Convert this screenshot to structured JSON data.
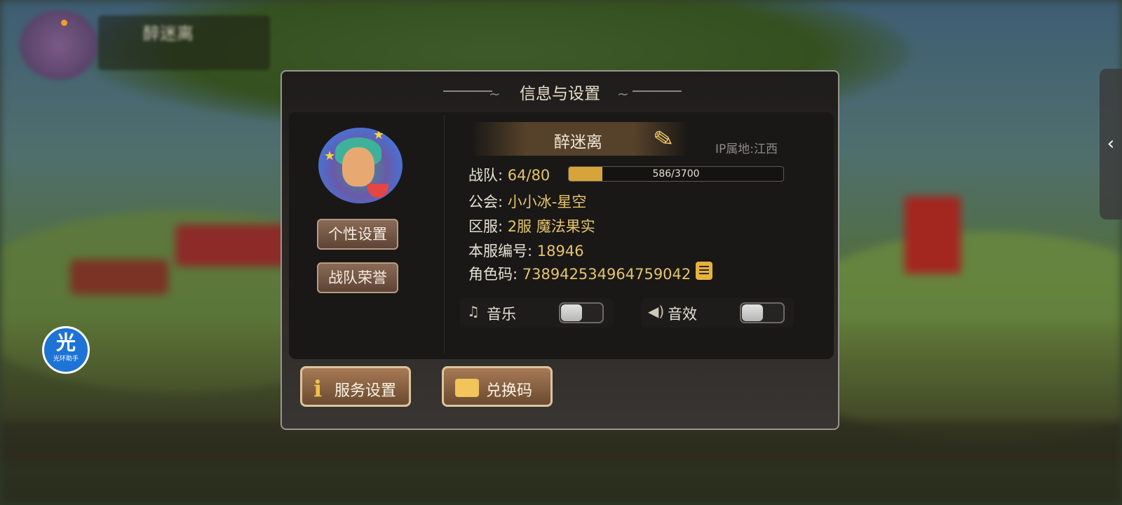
{
  "player": {
    "hud_name": "醉迷离"
  },
  "helper": {
    "icon_char": "光",
    "label": "光环助手"
  },
  "side_tab": {
    "icon": "chevron-left-icon",
    "glyph": "‹"
  },
  "dialog": {
    "title": "信息与设置",
    "name": "醉迷离",
    "ip_location": "IP属地:江西",
    "team_label": "战队:",
    "team_value": "64/80",
    "team_xp": {
      "current": 586,
      "max": 3700,
      "text": "586/3700"
    },
    "guild_label": "公会:",
    "guild_value": "小小冰-星空",
    "server_label": "区服:",
    "server_value": "2服 魔法果实",
    "server_no_label": "本服编号:",
    "server_no_value": "18946",
    "role_code_label": "角色码:",
    "role_code_value": "738942534964759042",
    "buttons": {
      "personal_settings": "个性设置",
      "team_honor": "战队荣誉",
      "service_settings": "服务设置",
      "redeem_code": "兑换码"
    },
    "toggles": {
      "music": {
        "label": "音乐",
        "on": false
      },
      "sound": {
        "label": "音效",
        "on": false
      }
    }
  },
  "colors": {
    "accent_gold": "#e6c46b",
    "button_brown": "#6a4a30",
    "helper_blue": "#1d73d6"
  }
}
